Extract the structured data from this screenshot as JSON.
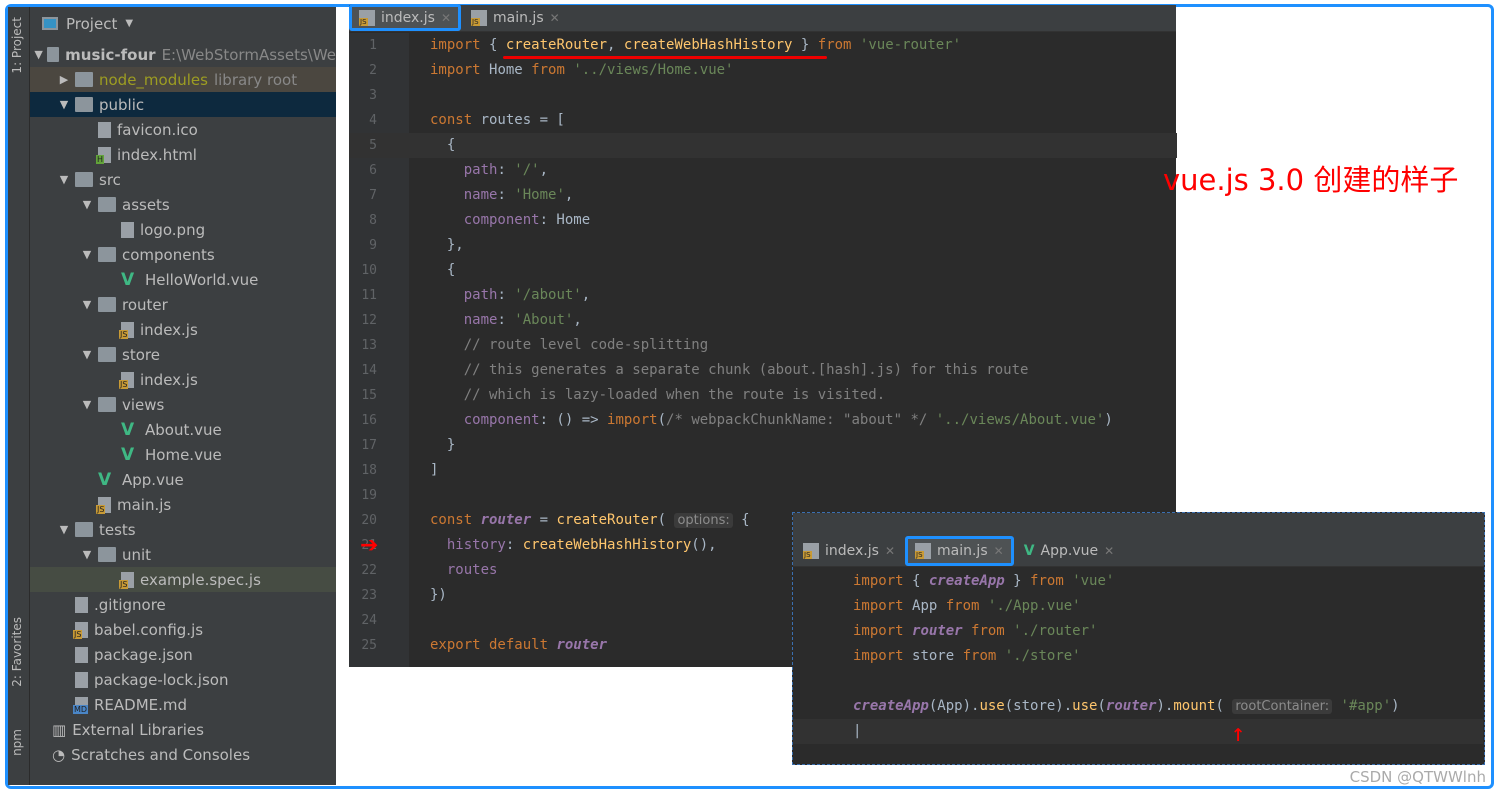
{
  "sidebar_tabs": {
    "project": "1: Project",
    "favorites": "2: Favorites",
    "npm": "npm"
  },
  "project_panel": {
    "title": "Project",
    "items": [
      {
        "label": "music-four",
        "extra": "E:\\WebStormAssets\\We",
        "level": 0,
        "type": "folder",
        "arrow": "down",
        "bold": true
      },
      {
        "label": "node_modules",
        "extra": "library root",
        "level": 1,
        "type": "folder",
        "arrow": "right",
        "style": "lib"
      },
      {
        "label": "public",
        "level": 1,
        "type": "folder",
        "arrow": "down",
        "style": "sel"
      },
      {
        "label": "favicon.ico",
        "level": 2,
        "type": "file",
        "badge": ""
      },
      {
        "label": "index.html",
        "level": 2,
        "type": "file",
        "badge": "H"
      },
      {
        "label": "src",
        "level": 1,
        "type": "folder",
        "arrow": "down"
      },
      {
        "label": "assets",
        "level": 2,
        "type": "folder",
        "arrow": "down"
      },
      {
        "label": "logo.png",
        "level": 3,
        "type": "file",
        "badge": ""
      },
      {
        "label": "components",
        "level": 2,
        "type": "folder",
        "arrow": "down"
      },
      {
        "label": "HelloWorld.vue",
        "level": 3,
        "type": "vue"
      },
      {
        "label": "router",
        "level": 2,
        "type": "folder",
        "arrow": "down"
      },
      {
        "label": "index.js",
        "level": 3,
        "type": "file",
        "badge": "JS"
      },
      {
        "label": "store",
        "level": 2,
        "type": "folder",
        "arrow": "down"
      },
      {
        "label": "index.js",
        "level": 3,
        "type": "file",
        "badge": "JS"
      },
      {
        "label": "views",
        "level": 2,
        "type": "folder",
        "arrow": "down"
      },
      {
        "label": "About.vue",
        "level": 3,
        "type": "vue"
      },
      {
        "label": "Home.vue",
        "level": 3,
        "type": "vue"
      },
      {
        "label": "App.vue",
        "level": 2,
        "type": "vue"
      },
      {
        "label": "main.js",
        "level": 2,
        "type": "file",
        "badge": "JS"
      },
      {
        "label": "tests",
        "level": 1,
        "type": "folder",
        "arrow": "down"
      },
      {
        "label": "unit",
        "level": 2,
        "type": "folder",
        "arrow": "down"
      },
      {
        "label": "example.spec.js",
        "level": 3,
        "type": "file",
        "badge": "JS",
        "style": "hl"
      },
      {
        "label": ".gitignore",
        "level": 1,
        "type": "file",
        "badge": ""
      },
      {
        "label": "babel.config.js",
        "level": 1,
        "type": "file",
        "badge": "JS"
      },
      {
        "label": "package.json",
        "level": 1,
        "type": "file",
        "badge": ""
      },
      {
        "label": "package-lock.json",
        "level": 1,
        "type": "file",
        "badge": ""
      },
      {
        "label": "README.md",
        "level": 1,
        "type": "file",
        "badge": "MD"
      },
      {
        "label": "External Libraries",
        "level": 0,
        "type": "lib"
      },
      {
        "label": "Scratches and Consoles",
        "level": 0,
        "type": "scratch"
      }
    ]
  },
  "editor": {
    "tabs": [
      {
        "label": "index.js",
        "active": true
      },
      {
        "label": "main.js",
        "active": false
      }
    ],
    "current_line": 5,
    "lines": [
      [
        [
          "kw",
          "import "
        ],
        [
          "pl",
          "{ "
        ],
        [
          "fn",
          "createRouter"
        ],
        [
          "pl",
          ", "
        ],
        [
          "fn",
          "createWebHashHistory"
        ],
        [
          "pl",
          " } "
        ],
        [
          "kw",
          "from "
        ],
        [
          "str",
          "'vue-router'"
        ]
      ],
      [
        [
          "kw",
          "import "
        ],
        [
          "pl",
          "Home "
        ],
        [
          "kw",
          "from "
        ],
        [
          "str",
          "'../views/Home.vue'"
        ]
      ],
      [],
      [
        [
          "kw",
          "const "
        ],
        [
          "pl",
          "routes = ["
        ]
      ],
      [
        [
          "pl",
          "  {"
        ]
      ],
      [
        [
          "prop",
          "    path"
        ],
        [
          "pl",
          ": "
        ],
        [
          "str",
          "'/'"
        ],
        [
          "pl",
          ","
        ]
      ],
      [
        [
          "prop",
          "    name"
        ],
        [
          "pl",
          ": "
        ],
        [
          "str",
          "'Home'"
        ],
        [
          "pl",
          ","
        ]
      ],
      [
        [
          "prop",
          "    component"
        ],
        [
          "pl",
          ": Home"
        ]
      ],
      [
        [
          "pl",
          "  },"
        ]
      ],
      [
        [
          "pl",
          "  {"
        ]
      ],
      [
        [
          "prop",
          "    path"
        ],
        [
          "pl",
          ": "
        ],
        [
          "str",
          "'/about'"
        ],
        [
          "pl",
          ","
        ]
      ],
      [
        [
          "prop",
          "    name"
        ],
        [
          "pl",
          ": "
        ],
        [
          "str",
          "'About'"
        ],
        [
          "pl",
          ","
        ]
      ],
      [
        [
          "cm",
          "    // route level code-splitting"
        ]
      ],
      [
        [
          "cm",
          "    // this generates a separate chunk (about.[hash].js) for this route"
        ]
      ],
      [
        [
          "cm",
          "    // which is lazy-loaded when the route is visited."
        ]
      ],
      [
        [
          "prop",
          "    component"
        ],
        [
          "pl",
          ": () => "
        ],
        [
          "kw",
          "import"
        ],
        [
          "pl",
          "("
        ],
        [
          "cm",
          "/* webpackChunkName: \"about\" */ "
        ],
        [
          "str",
          "'../views/About.vue'"
        ],
        [
          "pl",
          ")"
        ]
      ],
      [
        [
          "pl",
          "  }"
        ]
      ],
      [
        [
          "pl",
          "]"
        ]
      ],
      [],
      [
        [
          "kw",
          "const "
        ],
        [
          "ital",
          "router"
        ],
        [
          "pl",
          " = "
        ],
        [
          "fn",
          "createRouter"
        ],
        [
          "pl",
          "( "
        ],
        [
          "hint",
          "options:"
        ],
        [
          "pl",
          " {"
        ]
      ],
      [
        [
          "prop",
          "  history"
        ],
        [
          "pl",
          ": "
        ],
        [
          "fn",
          "createWebHashHistory"
        ],
        [
          "pl",
          "(),"
        ]
      ],
      [
        [
          "prop",
          "  routes"
        ]
      ],
      [
        [
          "pl",
          "})"
        ]
      ],
      [],
      [
        [
          "kw",
          "export default "
        ],
        [
          "ital",
          "router"
        ]
      ]
    ]
  },
  "annotation": "vue.js 3.0 创建的样子",
  "inset": {
    "tabs": [
      {
        "label": "index.js",
        "icon": "js",
        "active": false
      },
      {
        "label": "main.js",
        "icon": "js",
        "active": true
      },
      {
        "label": "App.vue",
        "icon": "vue",
        "active": false
      }
    ],
    "lines": [
      [
        [
          "kw",
          "import "
        ],
        [
          "pl",
          "{ "
        ],
        [
          "ital",
          "createApp"
        ],
        [
          "pl",
          " } "
        ],
        [
          "kw",
          "from "
        ],
        [
          "str",
          "'vue'"
        ]
      ],
      [
        [
          "kw",
          "import "
        ],
        [
          "pl",
          "App "
        ],
        [
          "kw",
          "from "
        ],
        [
          "str",
          "'./App.vue'"
        ]
      ],
      [
        [
          "kw",
          "import "
        ],
        [
          "ital",
          "router"
        ],
        [
          "kw",
          " from "
        ],
        [
          "str",
          "'./router'"
        ]
      ],
      [
        [
          "kw",
          "import "
        ],
        [
          "pl",
          "store "
        ],
        [
          "kw",
          "from "
        ],
        [
          "str",
          "'./store'"
        ]
      ],
      [],
      [
        [
          "ital",
          "createApp"
        ],
        [
          "pl",
          "(App)."
        ],
        [
          "fn",
          "use"
        ],
        [
          "pl",
          "(store)."
        ],
        [
          "fn",
          "use"
        ],
        [
          "pl",
          "("
        ],
        [
          "ital",
          "router"
        ],
        [
          "pl",
          ")."
        ],
        [
          "fn",
          "mount"
        ],
        [
          "pl",
          "( "
        ],
        [
          "hint",
          "rootContainer:"
        ],
        [
          "pl",
          " "
        ],
        [
          "str",
          "'#app'"
        ],
        [
          "pl",
          ")"
        ]
      ],
      [
        [
          "pl",
          "|"
        ]
      ]
    ]
  },
  "watermark": "CSDN @QTWWlnh",
  "colors": {
    "accent": "#1e90ff",
    "annotation": "#ff0000"
  }
}
